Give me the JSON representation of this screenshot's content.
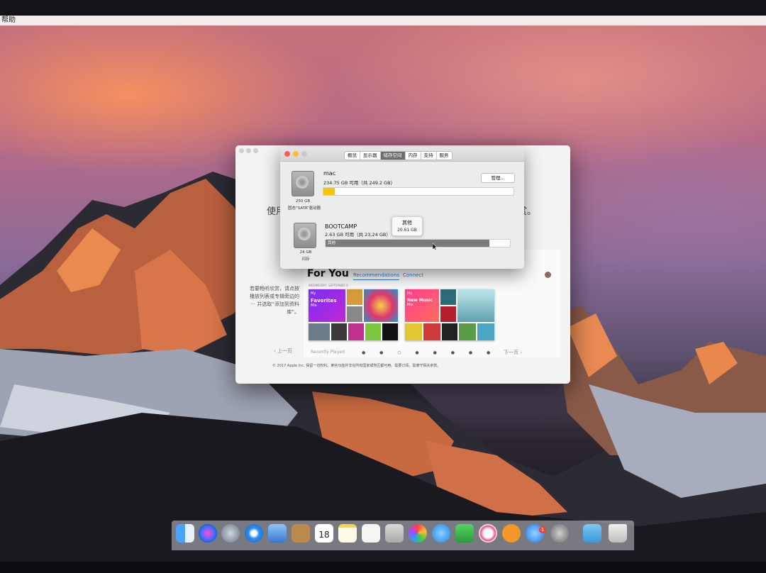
{
  "menubar": {
    "item": "帮助"
  },
  "background_window": {
    "side_text_left": "使用",
    "side_text_right": "赏。",
    "help_text": "若要畅听欣赏，请点按播放列表或专辑旁边的 ··· 并选取“添加到资料库”。",
    "music": {
      "header": "For You",
      "tabs": [
        "Recommendations",
        "Connect"
      ],
      "date": "WEDNESDAY, SEPTEMBER 6",
      "mix1": {
        "title": "My Favorites Mix",
        "lines": [
          "My",
          "Favorites",
          "Mix"
        ]
      },
      "mix2": {
        "title": "My New Music Mix",
        "lines": [
          "My",
          "New Music",
          "Mix"
        ]
      },
      "recently_played": "Recently Played"
    },
    "prev": "上一页",
    "next": "下一页",
    "dots": "● ● ○ ● ● ● ● ●",
    "copyright": "© 2017 Apple Inc. 保留一切权利。某些功能并非在所有国家或地区都可用。需要订阅，需遵守相关条款。"
  },
  "about_window": {
    "tabs": [
      "概览",
      "显示器",
      "储存空间",
      "内存",
      "支持",
      "服务"
    ],
    "active_tab": "储存空间",
    "disks": [
      {
        "name": "mac",
        "available": "234.75 GB 可用（共 249.2 GB）",
        "capacity": "250 GB",
        "type": "固态“SATA”驱动器",
        "used_fraction": 0.058,
        "fill_color": "#f7c500",
        "button": "管理..."
      },
      {
        "name": "BOOTCAMP",
        "available": "2.63 GB 可用（共 23.24 GB）",
        "capacity": "24 GB",
        "type": "闪存",
        "used_fraction": 0.887,
        "fill_color": "#7b7b7b",
        "bar_label": "其他"
      }
    ],
    "tooltip": {
      "title": "其他",
      "value": "20.61 GB"
    }
  },
  "dock": {
    "calendar_day": "18",
    "badge": "1",
    "icons": [
      "finder-icon",
      "siri-icon",
      "launchpad-icon",
      "safari-icon",
      "preview-icon",
      "notes-book-icon",
      "calendar-icon",
      "notes-icon",
      "reminders-icon",
      "stickies-icon",
      "photos-icon",
      "messages-icon",
      "facetime-icon",
      "itunes-icon",
      "ibooks-icon",
      "app-store-icon",
      "system-preferences-icon",
      "folder-icon",
      "trash-icon"
    ]
  }
}
